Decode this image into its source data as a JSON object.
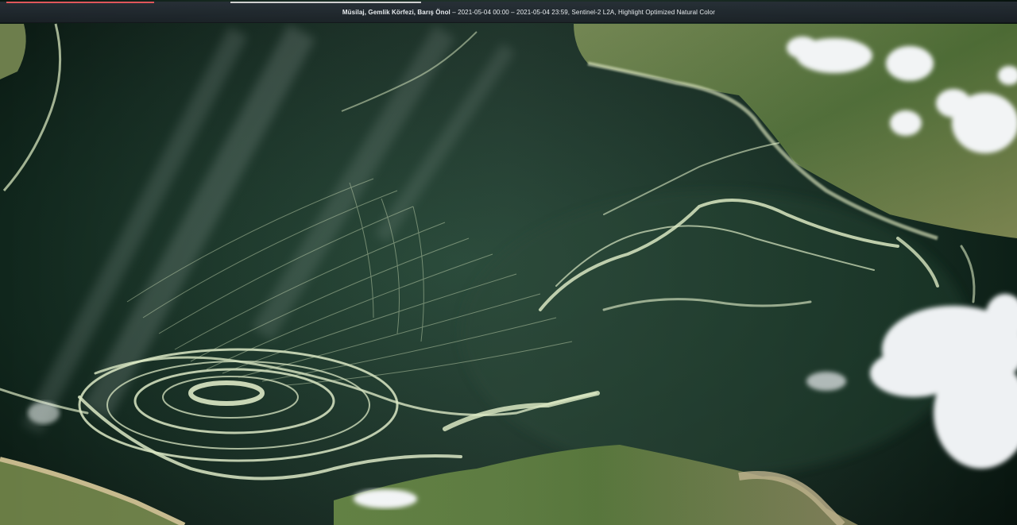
{
  "caption": {
    "title": "Müsilaj, Gemlik Körfezi, Barış Önol",
    "details": " – 2021-05-04 00:00 – 2021-05-04 23:59, Sentinel-2 L2A, Highlight Optimized Natural Color"
  },
  "colors": {
    "sea_deep": "#0b1a14",
    "sea_mid": "#183a2c",
    "mucilage": "#d8e6c0",
    "land_green": "#5a7a3a",
    "land_dry": "#a89a6a",
    "cloud": "#f2f4f5"
  }
}
